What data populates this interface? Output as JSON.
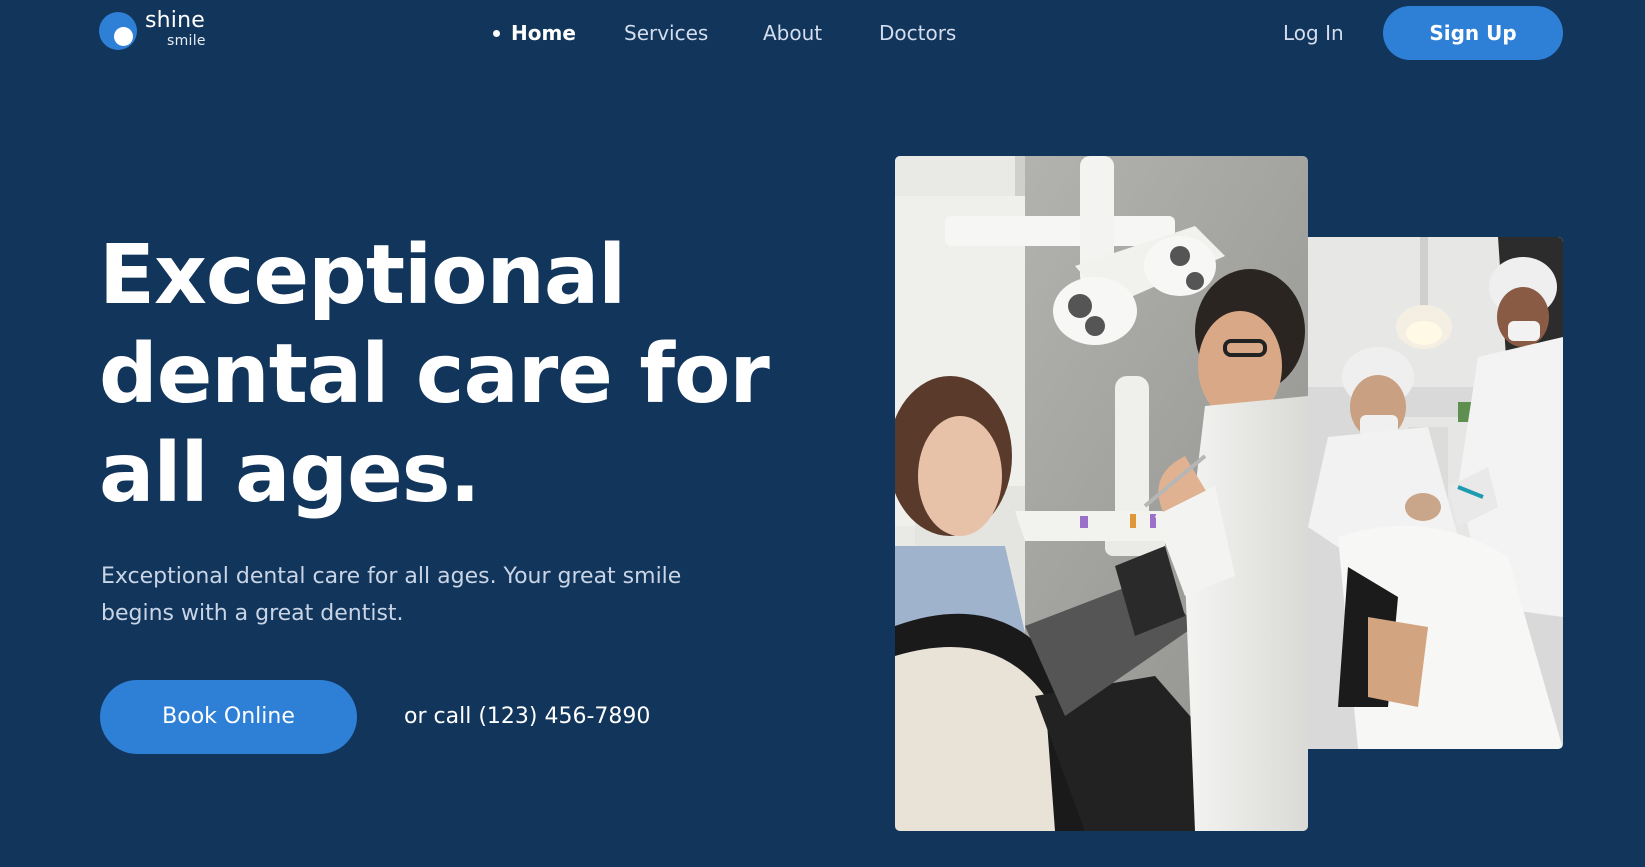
{
  "brand": {
    "name_line1": "shine",
    "name_line2": "smile",
    "accent_color": "#2e7fd6",
    "background_color": "#12355b"
  },
  "nav": {
    "items": [
      {
        "label": "Home",
        "active": true
      },
      {
        "label": "Services",
        "active": false
      },
      {
        "label": "About",
        "active": false
      },
      {
        "label": "Doctors",
        "active": false
      }
    ],
    "login_label": "Log In",
    "signup_label": "Sign Up"
  },
  "hero": {
    "title": "Exceptional dental care for all ages.",
    "subtitle": "Exceptional dental care for all ages. Your great smile begins with a great dentist.",
    "book_label": "Book Online",
    "call_prefix": "or call",
    "phone": "(123) 456-7890"
  },
  "images": {
    "main_photo_icon": "dentist-with-patient-photo",
    "side_photo_icon": "dental-team-procedure-photo"
  }
}
